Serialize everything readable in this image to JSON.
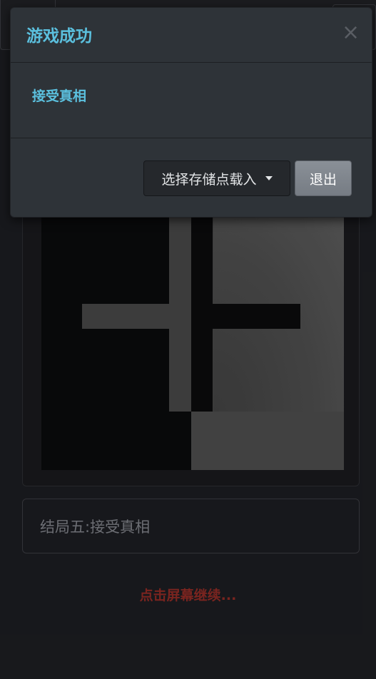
{
  "modal": {
    "title": "游戏成功",
    "close_label": "×",
    "message": "接受真相",
    "load_button_label": "选择存储点载入",
    "exit_button_label": "退出"
  },
  "ending": {
    "text": "结局五:接受真相"
  },
  "continue_prompt": "点击屏幕继续..."
}
